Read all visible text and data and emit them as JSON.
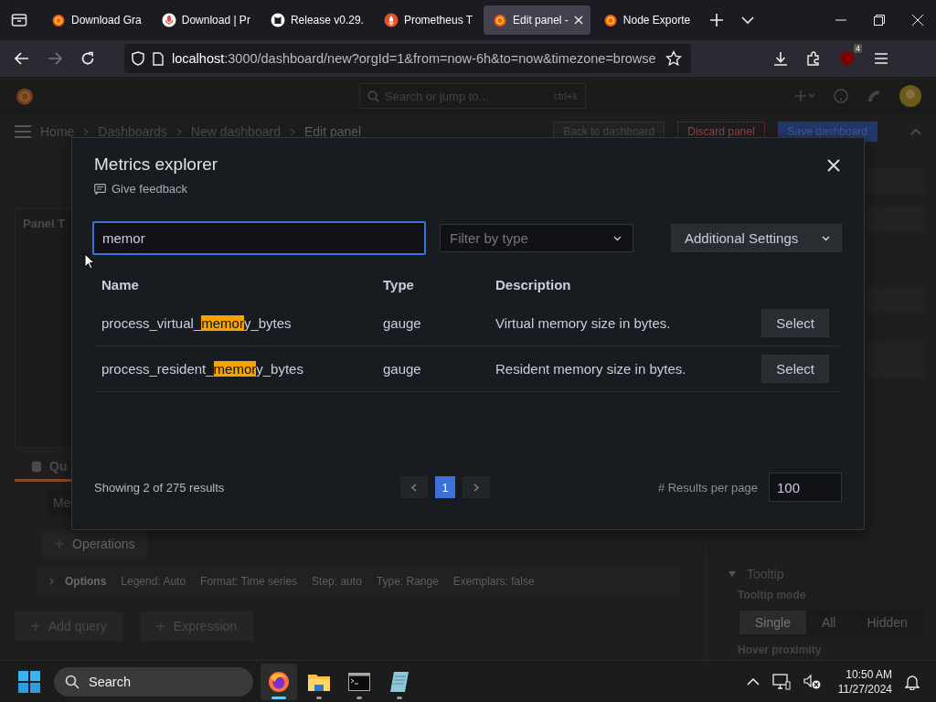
{
  "browser": {
    "tabs": [
      {
        "label": "Download Gra",
        "selected": false
      },
      {
        "label": "Download | Pr",
        "selected": false
      },
      {
        "label": "Release v0.29.",
        "selected": false
      },
      {
        "label": "Prometheus T",
        "selected": false
      },
      {
        "label": "Edit panel -",
        "selected": true
      },
      {
        "label": "Node Exporte",
        "selected": false
      }
    ],
    "url": {
      "host": "localhost",
      "rest": ":3000/dashboard/new?orgId=1&from=now-6h&to=now&timezone=browse"
    },
    "extension_badge": "4"
  },
  "grafana": {
    "search_placeholder": "Search or jump to...",
    "shortcut": "ctrl+k",
    "breadcrumbs": [
      "Home",
      "Dashboards",
      "New dashboard",
      "Edit panel"
    ],
    "actions": [
      {
        "label": "Back to dashboard",
        "kind": "secondary"
      },
      {
        "label": "Discard panel",
        "kind": "destructive"
      },
      {
        "label": "Save dashboard",
        "kind": "primary"
      }
    ],
    "panel_title": "Panel T",
    "query_tabs": [
      {
        "label": "Qu",
        "selected": true
      }
    ],
    "query_row_label": "Me",
    "operations": "Operations",
    "options": {
      "label": "Options",
      "summary": [
        "Legend: Auto",
        "Format: Time series",
        "Step: auto",
        "Type: Range",
        "Exemplars: false"
      ]
    },
    "add_buttons": [
      "Add query",
      "Expression"
    ],
    "options_pane": {
      "section": "Tooltip",
      "field_label": "Tooltip mode",
      "modes": [
        {
          "label": "Single",
          "selected": true
        },
        {
          "label": "All",
          "selected": false
        },
        {
          "label": "Hidden",
          "selected": false
        }
      ],
      "next_label": "Hover proximity"
    }
  },
  "modal": {
    "title": "Metrics explorer",
    "feedback": "Give feedback",
    "search": {
      "value": "memor"
    },
    "type_filter": {
      "placeholder": "Filter by type"
    },
    "settings_button": "Additional Settings",
    "columns": [
      "Name",
      "Type",
      "Description"
    ],
    "rows": [
      {
        "name": {
          "before": "process_virtual_",
          "match": "memor",
          "after": "y_bytes"
        },
        "type": "gauge",
        "description": "Virtual memory size in bytes.",
        "action": "Select"
      },
      {
        "name": {
          "before": "process_resident_",
          "match": "memor",
          "after": "y_bytes"
        },
        "type": "gauge",
        "description": "Resident memory size in bytes.",
        "action": "Select"
      }
    ],
    "summary": "Showing 2 of 275 results",
    "pages": [
      {
        "label": "1",
        "selected": true
      }
    ],
    "per_page_label": "# Results per page",
    "per_page": "100"
  },
  "taskbar": {
    "search": "Search",
    "apps": [
      {
        "selected": true
      },
      {
        "selected": false
      },
      {
        "selected": false
      },
      {
        "selected": false
      }
    ],
    "time": "10:50 AM",
    "date": "11/27/2024"
  }
}
